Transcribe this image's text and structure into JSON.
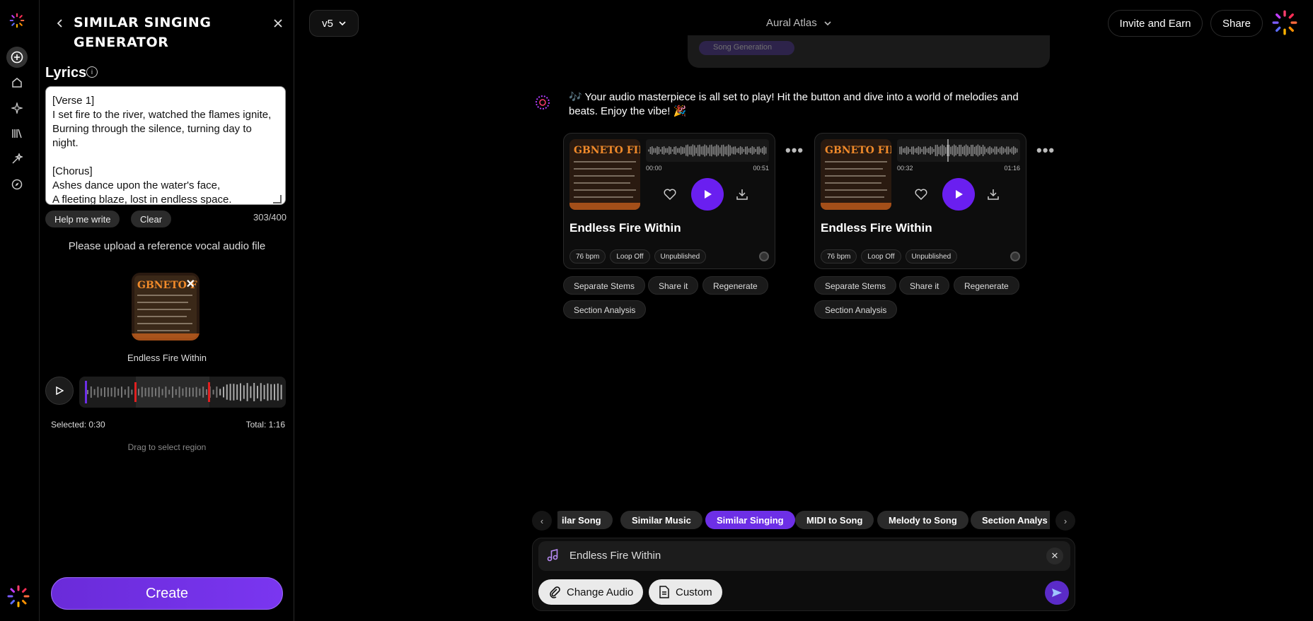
{
  "rail": {
    "items": [
      "create",
      "home",
      "explore",
      "library",
      "tools",
      "discover"
    ]
  },
  "panel": {
    "title": "SIMILAR SINGING GENERATOR",
    "lyrics_label": "Lyrics",
    "lyrics_text": "[Verse 1]\nI set fire to the river, watched the flames ignite,\nBurning through the silence, turning day to night.\n\n[Chorus]\nAshes dance upon the water's face,\nA fleeting blaze, lost in endless space.",
    "help_btn": "Help me write",
    "clear_btn": "Clear",
    "char_count": "303/400",
    "upload_msg": "Please upload a reference vocal audio file",
    "song_caption": "Endless Fire Within",
    "selected": "Selected: 0:30",
    "total": "Total: 1:16",
    "drag_hint": "Drag to select region",
    "create_btn": "Create"
  },
  "topbar": {
    "version": "v5",
    "project": "Aural Atlas",
    "invite": "Invite and Earn",
    "share": "Share"
  },
  "chat": {
    "previous_chip": "Song Generation",
    "message": "🎶 Your audio masterpiece is all set to play! Hit the button and dive into a world of melodies and beats. Enjoy the vibe! 🎉",
    "cards": [
      {
        "title": "Endless Fire Within",
        "time_start": "00:00",
        "time_end": "00:51",
        "tags": [
          "76 bpm",
          "Loop Off",
          "Unpublished"
        ],
        "actions": [
          "Separate Stems",
          "Share it",
          "Regenerate",
          "Section Analysis"
        ]
      },
      {
        "title": "Endless Fire Within",
        "time_start": "00:32",
        "time_end": "01:16",
        "tags": [
          "76 bpm",
          "Loop Off",
          "Unpublished"
        ],
        "actions": [
          "Separate Stems",
          "Share it",
          "Regenerate",
          "Section Analysis"
        ]
      }
    ]
  },
  "modes": [
    "ilar Song",
    "Similar Music",
    "Similar Singing",
    "MIDI to Song",
    "Melody to Song",
    "Section Analys"
  ],
  "active_mode": "Similar Singing",
  "composer": {
    "attachment": "Endless Fire Within",
    "change_audio": "Change Audio",
    "custom": "Custom"
  },
  "colors": {
    "accent": "#6d2fe6",
    "bg": "#000000"
  }
}
